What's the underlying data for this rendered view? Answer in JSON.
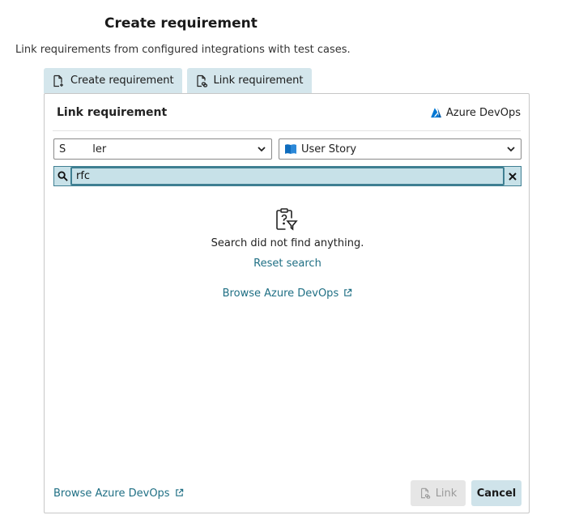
{
  "dialog": {
    "title": "Create requirement",
    "subtitle": "Link requirements from configured integrations with test cases."
  },
  "tabs": [
    {
      "label": "Create requirement",
      "icon": "document-plus-icon"
    },
    {
      "label": "Link requirement",
      "icon": "document-link-icon"
    }
  ],
  "panel": {
    "title": "Link requirement",
    "provider": "Azure DevOps",
    "provider_icon": "azure-devops-icon"
  },
  "filters": {
    "project": "S        ler",
    "work_item_type": "User Story"
  },
  "search": {
    "value": "rfc"
  },
  "empty_state": {
    "icon": "clipboard-question-filter-icon",
    "message": "Search did not find anything.",
    "reset_label": "Reset search",
    "browse_label": "Browse Azure DevOps"
  },
  "footer": {
    "browse_label": "Browse Azure DevOps",
    "link_label": "Link",
    "cancel_label": "Cancel"
  },
  "colors": {
    "accent": "#1f6f84",
    "tab_bg": "#d4e6ec",
    "search_bg": "#c7e1e8",
    "azure_blue": "#0078d4"
  }
}
